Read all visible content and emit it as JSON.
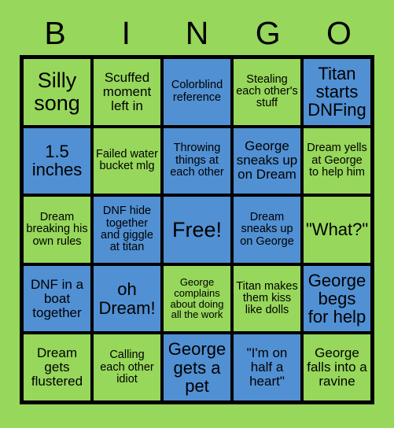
{
  "card": {
    "header_letters": [
      "B",
      "I",
      "N",
      "G",
      "O"
    ],
    "colors": {
      "background_green": "#97d75b",
      "cell_green": "#97d75b",
      "cell_blue": "#5190d3",
      "border_black": "#000000",
      "text_black": "#000000"
    },
    "grid": {
      "columns": 5,
      "rows": 5,
      "free_space_index": 12,
      "cells": [
        {
          "text": "Silly song",
          "color": "green",
          "size": "xl"
        },
        {
          "text": "Scuffed moment left in",
          "color": "green",
          "size": "md"
        },
        {
          "text": "Colorblind reference",
          "color": "blue",
          "size": "sm"
        },
        {
          "text": "Stealing each other's stuff",
          "color": "green",
          "size": "sm"
        },
        {
          "text": "Titan starts DNFing",
          "color": "blue",
          "size": "lg"
        },
        {
          "text": "1.5 inches",
          "color": "blue",
          "size": "lg"
        },
        {
          "text": "Failed water bucket mlg",
          "color": "green",
          "size": "sm"
        },
        {
          "text": "Throwing things at each other",
          "color": "blue",
          "size": "sm"
        },
        {
          "text": "George sneaks up on Dream",
          "color": "blue",
          "size": "md"
        },
        {
          "text": "Dream yells at George to help him",
          "color": "green",
          "size": "sm"
        },
        {
          "text": "Dream breaking his own rules",
          "color": "green",
          "size": "sm"
        },
        {
          "text": "DNF hide together and giggle at titan",
          "color": "blue",
          "size": "sm"
        },
        {
          "text": "Free!",
          "color": "blue",
          "size": "xl"
        },
        {
          "text": "Dream sneaks up on George",
          "color": "blue",
          "size": "sm"
        },
        {
          "text": "\"What?\"",
          "color": "green",
          "size": "lg"
        },
        {
          "text": "DNF in a boat together",
          "color": "blue",
          "size": "md"
        },
        {
          "text": "oh Dream!",
          "color": "blue",
          "size": "lg"
        },
        {
          "text": "George complains about doing all the work",
          "color": "green",
          "size": "xs"
        },
        {
          "text": "Titan makes them kiss like dolls",
          "color": "green",
          "size": "sm"
        },
        {
          "text": "George begs for help",
          "color": "blue",
          "size": "lg"
        },
        {
          "text": "Dream gets flustered",
          "color": "green",
          "size": "md"
        },
        {
          "text": "Calling each other idiot",
          "color": "green",
          "size": "sm"
        },
        {
          "text": "George gets a pet",
          "color": "blue",
          "size": "lg"
        },
        {
          "text": "\"I'm on half a heart\"",
          "color": "blue",
          "size": "md"
        },
        {
          "text": "George falls into a ravine",
          "color": "green",
          "size": "md"
        }
      ]
    }
  }
}
